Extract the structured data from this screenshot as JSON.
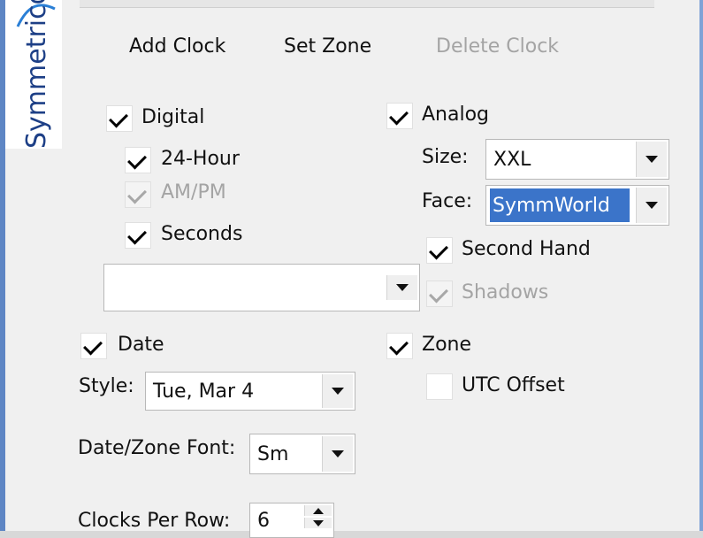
{
  "branding": {
    "logo_text": "Symmetricom"
  },
  "toolbar": {
    "add_clock": "Add Clock",
    "set_zone": "Set Zone",
    "delete_clock": "Delete Clock"
  },
  "digital": {
    "label": "Digital",
    "checked": true,
    "hour24": {
      "label": "24-Hour",
      "checked": true
    },
    "ampm": {
      "label": "AM/PM",
      "checked": true,
      "disabled": true
    },
    "seconds": {
      "label": "Seconds",
      "checked": true
    },
    "font_value": ""
  },
  "analog": {
    "label": "Analog",
    "checked": true,
    "size_label": "Size:",
    "size_value": "XXL",
    "face_label": "Face:",
    "face_value": "SymmWorld",
    "second_hand": {
      "label": "Second Hand",
      "checked": true
    },
    "shadows": {
      "label": "Shadows",
      "checked": true,
      "disabled": true
    }
  },
  "date": {
    "label": "Date",
    "checked": true,
    "style_label": "Style:",
    "style_value": "Tue, Mar 4"
  },
  "zone": {
    "label": "Zone",
    "checked": true,
    "utc_offset": {
      "label": "UTC Offset",
      "checked": false
    }
  },
  "font": {
    "label": "Date/Zone Font:",
    "value": "Sm"
  },
  "clocks_per_row": {
    "label": "Clocks Per Row:",
    "value": "6"
  },
  "colors": {
    "selection": "#3b74c9",
    "frame": "#5e86c4",
    "logo": "#1d3f86"
  }
}
